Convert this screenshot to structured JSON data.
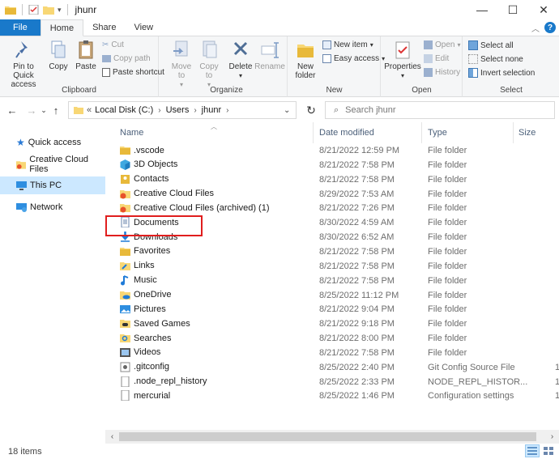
{
  "window": {
    "title": "jhunr",
    "minimize": "—",
    "maximize": "☐",
    "close": "✕"
  },
  "tabs": {
    "file": "File",
    "home": "Home",
    "share": "Share",
    "view": "View"
  },
  "ribbon": {
    "clipboard": {
      "label": "Clipboard",
      "pin": "Pin to Quick access",
      "copy": "Copy",
      "paste": "Paste",
      "cut": "Cut",
      "copy_path": "Copy path",
      "paste_shortcut": "Paste shortcut"
    },
    "organize": {
      "label": "Organize",
      "move_to": "Move to",
      "copy_to": "Copy to",
      "delete": "Delete",
      "rename": "Rename"
    },
    "new": {
      "label": "New",
      "new_folder": "New folder",
      "new_item": "New item",
      "easy_access": "Easy access"
    },
    "open": {
      "label": "Open",
      "properties": "Properties",
      "open": "Open",
      "edit": "Edit",
      "history": "History"
    },
    "select": {
      "label": "Select",
      "select_all": "Select all",
      "select_none": "Select none",
      "invert": "Invert selection"
    }
  },
  "address": {
    "overflow": "«",
    "crumbs": [
      "Local Disk (C:)",
      "Users",
      "jhunr"
    ],
    "search_placeholder": "Search jhunr"
  },
  "nav": {
    "items": [
      "Quick access",
      "Creative Cloud Files",
      "This PC",
      "Network"
    ]
  },
  "columns": {
    "name": "Name",
    "date": "Date modified",
    "type": "Type",
    "size": "Size"
  },
  "files": [
    {
      "name": ".vscode",
      "date": "8/21/2022 12:59 PM",
      "type": "File folder",
      "size": ""
    },
    {
      "name": "3D Objects",
      "date": "8/21/2022 7:58 PM",
      "type": "File folder",
      "size": ""
    },
    {
      "name": "Contacts",
      "date": "8/21/2022 7:58 PM",
      "type": "File folder",
      "size": ""
    },
    {
      "name": "Creative Cloud Files",
      "date": "8/29/2022 7:53 AM",
      "type": "File folder",
      "size": ""
    },
    {
      "name": "Creative Cloud Files (archived) (1)",
      "date": "8/21/2022 7:26 PM",
      "type": "File folder",
      "size": ""
    },
    {
      "name": "Documents",
      "date": "8/30/2022 4:59 AM",
      "type": "File folder",
      "size": ""
    },
    {
      "name": "Downloads",
      "date": "8/30/2022 6:52 AM",
      "type": "File folder",
      "size": ""
    },
    {
      "name": "Favorites",
      "date": "8/21/2022 7:58 PM",
      "type": "File folder",
      "size": ""
    },
    {
      "name": "Links",
      "date": "8/21/2022 7:58 PM",
      "type": "File folder",
      "size": ""
    },
    {
      "name": "Music",
      "date": "8/21/2022 7:58 PM",
      "type": "File folder",
      "size": ""
    },
    {
      "name": "OneDrive",
      "date": "8/25/2022 11:12 PM",
      "type": "File folder",
      "size": ""
    },
    {
      "name": "Pictures",
      "date": "8/21/2022 9:04 PM",
      "type": "File folder",
      "size": ""
    },
    {
      "name": "Saved Games",
      "date": "8/21/2022 9:18 PM",
      "type": "File folder",
      "size": ""
    },
    {
      "name": "Searches",
      "date": "8/21/2022 8:00 PM",
      "type": "File folder",
      "size": ""
    },
    {
      "name": "Videos",
      "date": "8/21/2022 7:58 PM",
      "type": "File folder",
      "size": ""
    },
    {
      "name": ".gitconfig",
      "date": "8/25/2022 2:40 PM",
      "type": "Git Config Source File",
      "size": "1"
    },
    {
      "name": ".node_repl_history",
      "date": "8/25/2022 2:33 PM",
      "type": "NODE_REPL_HISTOR...",
      "size": "1"
    },
    {
      "name": "mercurial",
      "date": "8/25/2022 1:46 PM",
      "type": "Configuration settings",
      "size": "1"
    }
  ],
  "icons": {
    "folder": "#f8d775",
    "selected_nav": "#cce8ff",
    "accent": "#1979ca",
    "highlight": "#e01e1e"
  },
  "status": {
    "count": "18 items"
  }
}
